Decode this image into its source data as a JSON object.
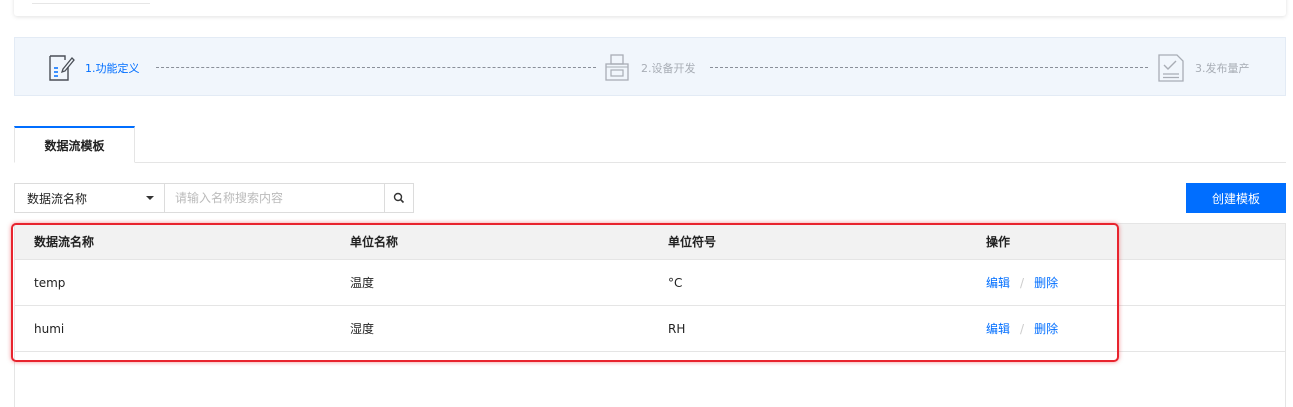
{
  "steps": [
    {
      "label": "1.功能定义",
      "icon": "document-edit-icon",
      "active": true
    },
    {
      "label": "2.设备开发",
      "icon": "printer-icon",
      "active": false
    },
    {
      "label": "3.发布量产",
      "icon": "checklist-icon",
      "active": false
    }
  ],
  "tabs": [
    {
      "label": "数据流模板"
    }
  ],
  "filter": {
    "select_value": "数据流名称",
    "search_placeholder": "请输入名称搜索内容"
  },
  "create_button": "创建模板",
  "table": {
    "headers": [
      "数据流名称",
      "单位名称",
      "单位符号",
      "操作"
    ],
    "rows": [
      {
        "name": "temp",
        "unit_name": "温度",
        "unit_symbol": "°C",
        "actions": [
          "编辑",
          "删除"
        ]
      },
      {
        "name": "humi",
        "unit_name": "湿度",
        "unit_symbol": "RH",
        "actions": [
          "编辑",
          "删除"
        ]
      }
    ]
  },
  "colors": {
    "accent": "#006eff",
    "highlight": "#e8242e",
    "steps_bg": "#f1f6fc"
  }
}
